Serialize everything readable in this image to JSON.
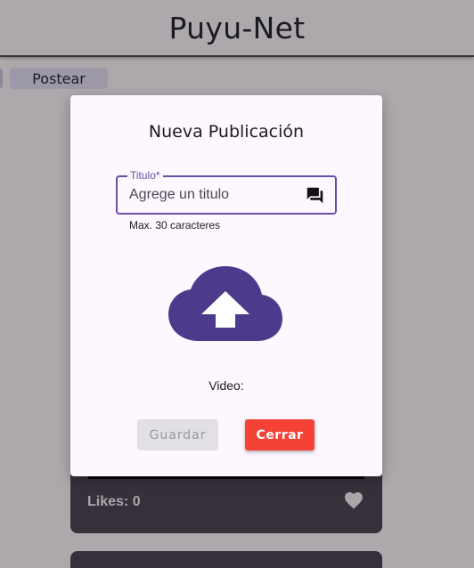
{
  "app": {
    "title": "Puyu-Net",
    "post_button_label": "Postear"
  },
  "feed": {
    "card": {
      "likes_text": "Likes: 0",
      "like_icon": "heart-icon"
    }
  },
  "dialog": {
    "title": "Nueva Publicación",
    "title_field": {
      "label": "Titulo*",
      "placeholder": "Agrege un titulo",
      "value": "",
      "helper": "Max. 30 caracteres",
      "icon": "chat-icon"
    },
    "upload_icon": "cloud-upload-icon",
    "video_label": "Video:",
    "save_label": "Guardar",
    "close_label": "Cerrar"
  },
  "colors": {
    "primary": "#6750A4",
    "upload_icon": "#4E3A8C",
    "close_button": "#F44336",
    "dialog_bg": "#FEF7FF",
    "scrim": "#ACA8AC",
    "card_bg": "#36303B"
  }
}
